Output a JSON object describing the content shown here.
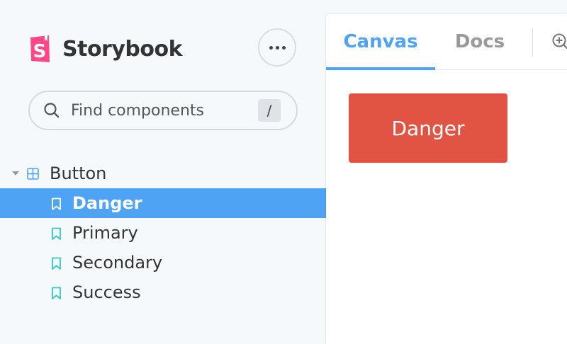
{
  "brand": {
    "name": "Storybook",
    "logo_letter": "S",
    "logo_icon": "storybook-logo-icon",
    "accent": "#ff4785"
  },
  "menu": {
    "icon": "more-dots-icon"
  },
  "search": {
    "placeholder": "Find components",
    "value": "",
    "shortcut": "/",
    "icon": "search-icon"
  },
  "tree": {
    "group": {
      "label": "Button",
      "icon": "component-grid-icon",
      "expanded": true
    },
    "stories": [
      {
        "label": "Danger",
        "selected": true
      },
      {
        "label": "Primary",
        "selected": false
      },
      {
        "label": "Secondary",
        "selected": false
      },
      {
        "label": "Success",
        "selected": false
      }
    ]
  },
  "preview": {
    "tabs": [
      {
        "label": "Canvas",
        "active": true
      },
      {
        "label": "Docs",
        "active": false
      }
    ],
    "zoom_icon": "zoom-in-icon",
    "component": {
      "label": "Danger",
      "color": "#e15444"
    }
  },
  "colors": {
    "selection": "#4ea3f5",
    "story_icon": "#2fc9c0",
    "component_icon": "#4ea3f5",
    "sidebar_bg": "#f6f9fc"
  }
}
